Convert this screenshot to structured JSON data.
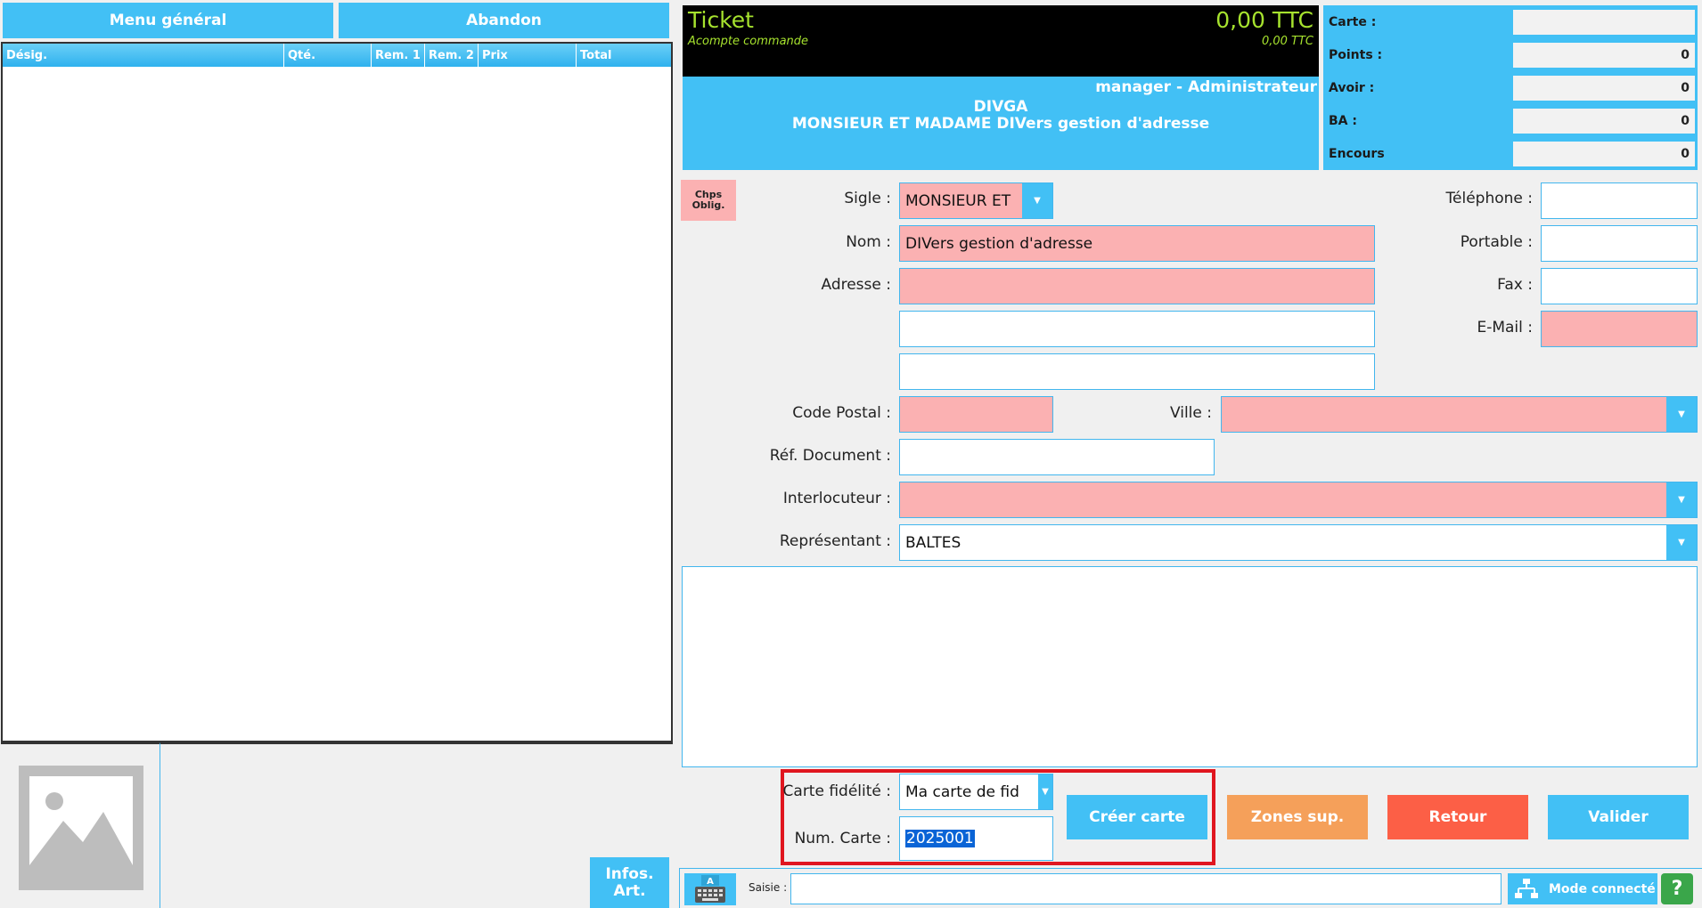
{
  "top_buttons": {
    "menu": "Menu général",
    "abandon": "Abandon"
  },
  "table": {
    "columns": [
      "Désig.",
      "Qté.",
      "Rem. 1",
      "Rem. 2",
      "Prix",
      "Total"
    ]
  },
  "infos_art": {
    "line1": "Infos.",
    "line2": "Art."
  },
  "ticket": {
    "title": "Ticket",
    "amount": "0,00 TTC",
    "subtitle": "Acompte commande",
    "sub_amount": "0,00 TTC",
    "user": "manager - Administrateur",
    "client_code": "DIVGA",
    "client_name": "MONSIEUR ET MADAME DIVers gestion d'adresse"
  },
  "side_panel": [
    {
      "label": "Carte :",
      "value": ""
    },
    {
      "label": "Points :",
      "value": "0"
    },
    {
      "label": "Avoir :",
      "value": "0"
    },
    {
      "label": "BA :",
      "value": "0"
    },
    {
      "label": "Encours",
      "value": "0"
    }
  ],
  "required_badge": {
    "line1": "Chps",
    "line2": "Oblig."
  },
  "form": {
    "sigle_label": "Sigle :",
    "sigle_value": "MONSIEUR ET",
    "nom_label": "Nom :",
    "nom_value": "DIVers gestion d'adresse",
    "adresse_label": "Adresse :",
    "adresse1": "",
    "adresse2": "",
    "adresse3": "",
    "cp_label": "Code Postal :",
    "cp_value": "",
    "ville_label": "Ville :",
    "ville_value": "",
    "ref_label": "Réf. Document :",
    "ref_value": "",
    "interlocuteur_label": "Interlocuteur :",
    "interlocuteur_value": "",
    "representant_label": "Représentant :",
    "representant_value": "BALTES",
    "telephone_label": "Téléphone :",
    "telephone_value": "",
    "portable_label": "Portable :",
    "portable_value": "",
    "fax_label": "Fax :",
    "fax_value": "",
    "email_label": "E-Mail :",
    "email_value": "",
    "notes": ""
  },
  "fidelite": {
    "carte_label": "Carte fidélité :",
    "carte_value": "Ma carte de fid",
    "num_label": "Num. Carte :",
    "num_value": "2025001"
  },
  "actions": {
    "creer": "Créer carte",
    "zones": "Zones sup.",
    "retour": "Retour",
    "valider": "Valider"
  },
  "bottom_bar": {
    "saisie_label": "Saisie :",
    "saisie_value": "",
    "mode": "Mode connecté",
    "help": "?"
  },
  "colors": {
    "accent": "#42c0f5",
    "required": "#fbb1b2",
    "zones": "#f5a05a",
    "retour": "#fc5f46",
    "highlight": "#e0161f"
  }
}
